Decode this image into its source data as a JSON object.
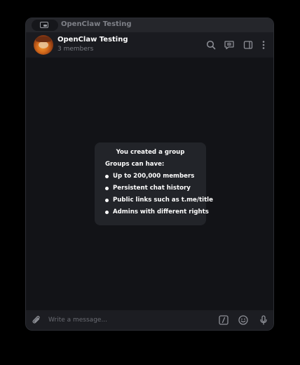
{
  "window": {
    "title": "OpenClaw Testing"
  },
  "header": {
    "chat_name": "OpenClaw Testing",
    "members": "3 members",
    "icons": [
      "search-icon",
      "video-chat-icon",
      "sidebar-toggle-icon",
      "more-icon"
    ]
  },
  "service_message": {
    "title": "You created a group",
    "subtitle": "Groups can have:",
    "features": [
      "Up to 200,000 members",
      "Persistent chat history",
      "Public links such as t.me/title",
      "Admins with different rights"
    ]
  },
  "composer": {
    "placeholder": "Write a message...",
    "value": "",
    "icons": [
      "attach-icon",
      "commands-icon",
      "emoji-icon",
      "microphone-icon"
    ]
  },
  "colors": {
    "page_background": "#000000",
    "window_background": "#121317",
    "header_background": "#1a1b20",
    "card_background": "#222429",
    "icon_color": "#8e9097",
    "text_primary": "#ffffff",
    "text_secondary": "#7a7c83"
  }
}
